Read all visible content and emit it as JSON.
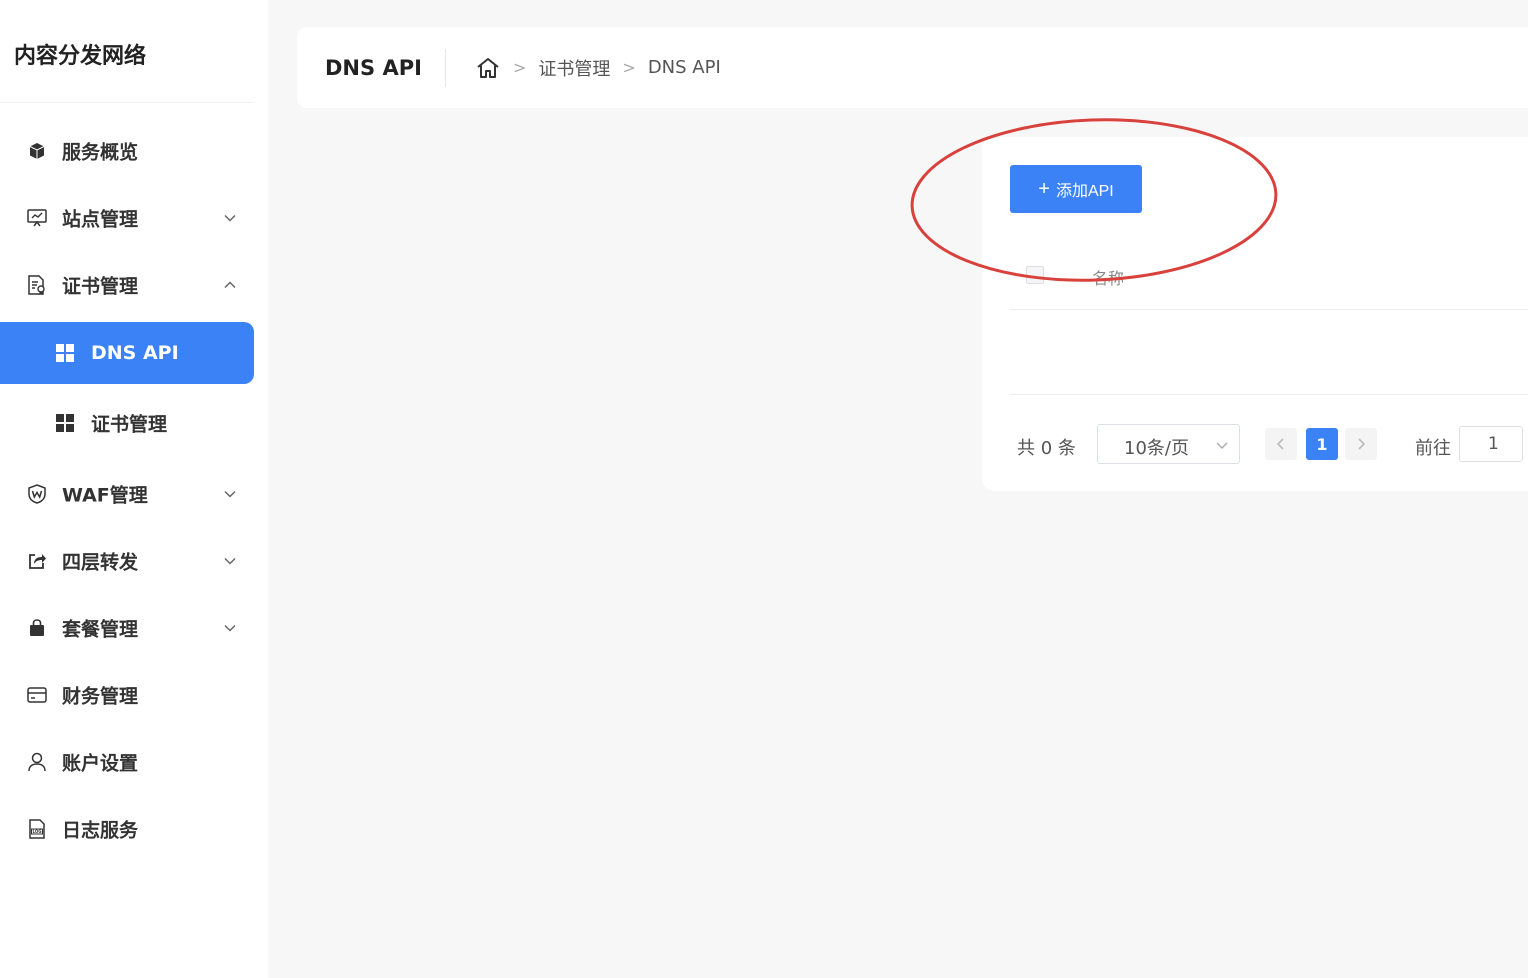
{
  "sidebar": {
    "brand": "内容分发网络",
    "items": [
      {
        "label": "服务概览",
        "icon": "cube-icon"
      },
      {
        "label": "站点管理",
        "icon": "monitor-icon",
        "chevron": "down"
      },
      {
        "label": "证书管理",
        "icon": "certificate-icon",
        "chevron": "up"
      },
      {
        "label": "WAF管理",
        "icon": "waf-shield-icon",
        "chevron": "down"
      },
      {
        "label": "四层转发",
        "icon": "share-icon",
        "chevron": "down"
      },
      {
        "label": "套餐管理",
        "icon": "bag-icon",
        "chevron": "down"
      },
      {
        "label": "财务管理",
        "icon": "card-icon"
      },
      {
        "label": "账户设置",
        "icon": "user-icon"
      },
      {
        "label": "日志服务",
        "icon": "log-icon"
      }
    ],
    "subitems": [
      {
        "label": "DNS API",
        "icon": "grid-icon",
        "active": true
      },
      {
        "label": "证书管理",
        "icon": "grid-icon",
        "active": false
      }
    ]
  },
  "header": {
    "title": "DNS API",
    "breadcrumb": [
      "证书管理",
      "DNS API"
    ]
  },
  "toolbar": {
    "add_label": "添加API"
  },
  "table": {
    "columns": [
      "名称"
    ]
  },
  "pagination": {
    "total": "共 0 条",
    "page_size": "10条/页",
    "current_page": "1",
    "goto_label": "前往",
    "goto_value": "1"
  },
  "colors": {
    "accent": "#3b82f6",
    "annotation": "#d9413c"
  }
}
